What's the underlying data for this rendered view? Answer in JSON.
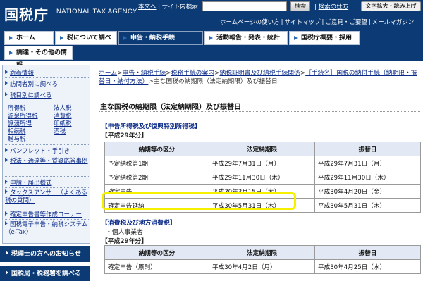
{
  "header": {
    "logo_ja": "国税庁",
    "logo_en": "NATIONAL TAX AGENCY",
    "text_link": "本文へ",
    "sep": "|",
    "search_label": "サイト内検索",
    "search_value": "",
    "search_button": "検索",
    "search_help": "検索の仕方",
    "font_button": "文字拡大・読み上げ",
    "sublinks": [
      "ホームページの使い方",
      "サイトマップ",
      "ご意見・ご要望",
      "メールマガジン"
    ]
  },
  "gnav": {
    "items": [
      "ホーム",
      "税について調べる",
      "申告・納税手続",
      "活動報告・発表・統計",
      "国税庁概要・採用",
      "調達・その他の情報"
    ]
  },
  "sidebar": {
    "links": {
      "news": "新着情報",
      "visitors": "訪問者別に調べる",
      "by_tax": "税目別に調べる",
      "pamphlet": "パンフレット・手引き",
      "notices": "税法・通達等・質疑応答事例",
      "applications": "申請・届出様式",
      "taxanswer": "タックスアンサー（よくある税の質問）",
      "kakutei": "確定申告書等作成コーナー",
      "etax": "国税電子申告・納税システム（e-Tax）"
    },
    "tax_items": [
      "所得税",
      "法人税",
      "源泉所得税",
      "消費税",
      "譲渡所得",
      "印紙税",
      "相続税",
      "酒税",
      "贈与税"
    ],
    "dark_buttons": [
      "税理士の方へのお知らせ",
      "国税局・税務署を調べる"
    ]
  },
  "main": {
    "breadcrumb": [
      "ホーム",
      "申告・納税手続",
      "税務手続の案内",
      "納税証明書及び納税手続関係",
      "［手続名］国税の納付手続（納期限・振替日・納付方法）",
      "主な国税の納期限（法定納期限）及び振替日"
    ],
    "bc_sep": ">",
    "title": "主な国税の納期限（法定納期限）及び振替日",
    "section1": {
      "heading": "【申告所得税及び復興特別所得税】",
      "year": "【平成29年分】",
      "headers": [
        "納期等の区分",
        "法定納期限",
        "振替日"
      ],
      "rows": [
        [
          "予定納税第1期",
          "平成29年7月31日（月）",
          "平成29年7月31日（月）"
        ],
        [
          "予定納税第2期",
          "平成29年11月30日（木）",
          "平成29年11月30日（木）"
        ],
        [
          "確定申告",
          "平成30年3月15日（木）",
          "平成30年4月20日（金）"
        ],
        [
          "確定申告延納",
          "平成30年5月31日（木）",
          "平成30年5月31日（木）"
        ]
      ]
    },
    "section2": {
      "heading": "【消費税及び地方消費税】",
      "note": "・個人事業者",
      "year": "【平成29年分】",
      "headers": [
        "納期等の区分",
        "法定納期限",
        "振替日"
      ],
      "rows": [
        [
          "確定申告（原則）",
          "平成30年4月2日（月）",
          "平成30年4月25日（水）"
        ]
      ]
    }
  },
  "colors": {
    "brand_navy": "#0b3a74",
    "link": "#0a2a88",
    "highlight": "#f5ef00",
    "table_header": "#e2e9f4"
  }
}
